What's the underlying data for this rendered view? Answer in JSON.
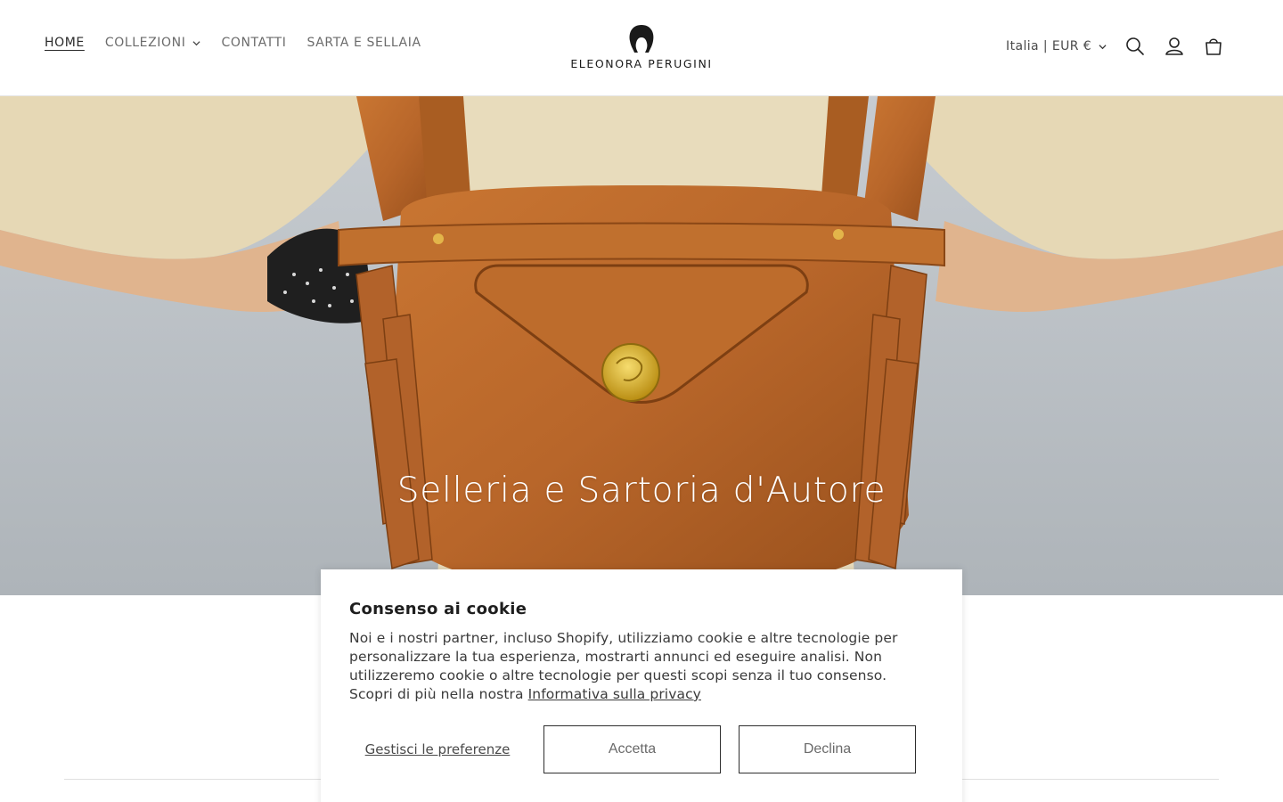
{
  "header": {
    "nav": [
      {
        "label": "HOME",
        "active": true,
        "has_dropdown": false
      },
      {
        "label": "COLLEZIONI",
        "active": false,
        "has_dropdown": true
      },
      {
        "label": "CONTATTI",
        "active": false,
        "has_dropdown": false
      },
      {
        "label": "SARTA E SELLAIA",
        "active": false,
        "has_dropdown": false
      }
    ],
    "brand": "ELEONORA PERUGINI",
    "locale": "Italia | EUR €",
    "icons": [
      "search-icon",
      "account-icon",
      "cart-icon"
    ]
  },
  "hero": {
    "title": "Selleria e Sartoria d'Autore"
  },
  "cookie_banner": {
    "title": "Consenso ai cookie",
    "body": "Noi e i nostri partner, incluso Shopify, utilizziamo cookie e altre tecnologie per personalizzare la tua esperienza, mostrarti annunci ed eseguire analisi. Non utilizzeremo cookie o altre tecnologie per questi scopi senza il tuo consenso. Scopri di più nella nostra",
    "privacy_link": "Informativa sulla privacy",
    "manage_label": "Gestisci le preferenze",
    "accept_label": "Accetta",
    "decline_label": "Declina"
  },
  "colors": {
    "text": "#121212",
    "nav_muted": "#6b6b6b",
    "leather": "#b8662a",
    "background": "#ffffff"
  }
}
